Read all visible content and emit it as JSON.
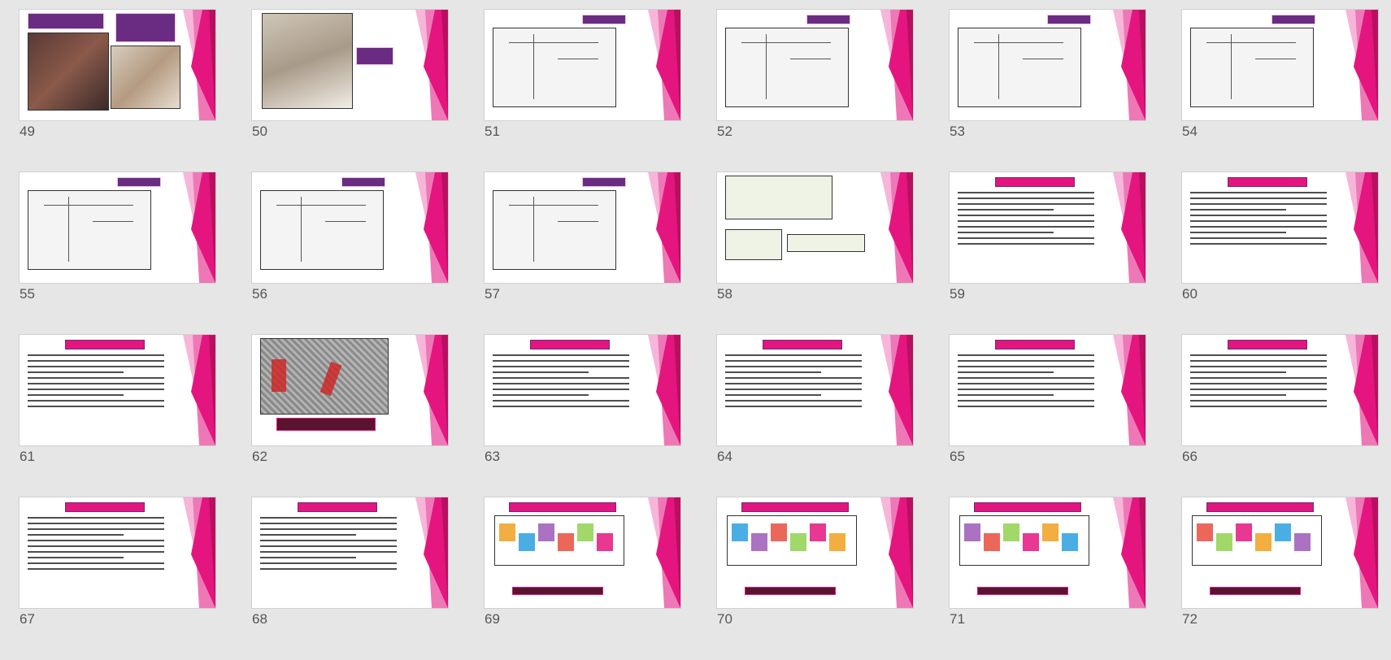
{
  "view": "slide-sorter",
  "colors": {
    "background": "#e6e6e6",
    "slide_accent_pink": "#e4157e",
    "slide_title_purple": "#6a2c82",
    "slide_number": "#555555"
  },
  "slides": [
    {
      "number": "49",
      "kind": "photos"
    },
    {
      "number": "50",
      "kind": "photo-with-labels"
    },
    {
      "number": "51",
      "kind": "drawing"
    },
    {
      "number": "52",
      "kind": "drawing"
    },
    {
      "number": "53",
      "kind": "drawing"
    },
    {
      "number": "54",
      "kind": "drawing"
    },
    {
      "number": "55",
      "kind": "drawing"
    },
    {
      "number": "56",
      "kind": "drawing"
    },
    {
      "number": "57",
      "kind": "drawing"
    },
    {
      "number": "58",
      "kind": "table"
    },
    {
      "number": "59",
      "kind": "text"
    },
    {
      "number": "60",
      "kind": "text"
    },
    {
      "number": "61",
      "kind": "text"
    },
    {
      "number": "62",
      "kind": "map"
    },
    {
      "number": "63",
      "kind": "text"
    },
    {
      "number": "64",
      "kind": "text"
    },
    {
      "number": "65",
      "kind": "text"
    },
    {
      "number": "66",
      "kind": "text"
    },
    {
      "number": "67",
      "kind": "text"
    },
    {
      "number": "68",
      "kind": "text"
    },
    {
      "number": "69",
      "kind": "plan"
    },
    {
      "number": "70",
      "kind": "plan"
    },
    {
      "number": "71",
      "kind": "plan"
    },
    {
      "number": "72",
      "kind": "plan"
    }
  ]
}
